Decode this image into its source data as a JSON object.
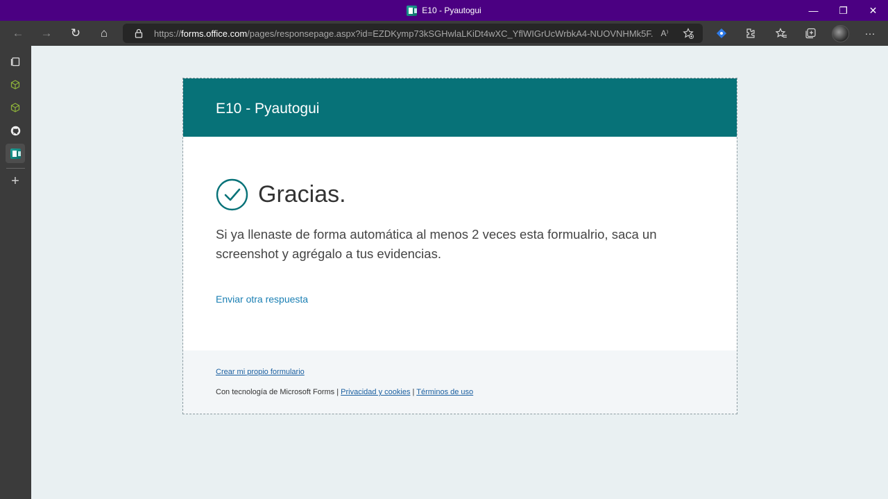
{
  "window": {
    "title": "E10 - Pyautogui",
    "controls": {
      "minimize": "—",
      "restore": "❐",
      "close": "✕"
    }
  },
  "toolbar": {
    "back": "←",
    "forward": "→",
    "refresh": "↻",
    "home": "⌂",
    "url_prefix": "https://",
    "url_domain": "forms.office.com",
    "url_rest": "/pages/responsepage.aspx?id=EZDKymp73kSGHwlaLKiDt4wXC_YflWIGrUcWrbkA4-NUOVNHMk5F...",
    "read_aloud": "A⁾",
    "more": "···"
  },
  "sidebar": {
    "items": [
      {
        "name": "tabs-icon",
        "glyph": "❐"
      },
      {
        "name": "cube-icon-1",
        "glyph": "⬡"
      },
      {
        "name": "cube-icon-2",
        "glyph": "⬡"
      },
      {
        "name": "github-icon",
        "glyph": "●"
      },
      {
        "name": "forms-icon",
        "glyph": ""
      },
      {
        "name": "add-icon",
        "glyph": "+"
      }
    ]
  },
  "form": {
    "title": "E10 - Pyautogui",
    "thanks": "Gracias.",
    "message": "Si ya llenaste de forma automática al menos 2 veces esta formualrio, saca un screenshot y agrégalo a tus evidencias.",
    "submit_again": "Enviar otra respuesta",
    "accent_color": "#077278"
  },
  "footer": {
    "create_link": "Crear mi propio formulario",
    "powered_by": "Con tecnología de Microsoft Forms",
    "separator": "|",
    "privacy_link": "Privacidad y cookies",
    "terms_link": "Términos de uso"
  }
}
